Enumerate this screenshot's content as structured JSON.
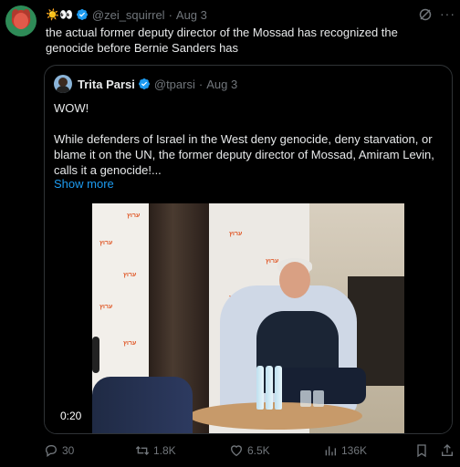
{
  "author": {
    "emoji": "☀️👀",
    "handle": "@zei_squirrel",
    "date": "Aug 3"
  },
  "tweet": {
    "text": "the actual former deputy director of the Mossad has recognized the genocide before Bernie Sanders has"
  },
  "quote": {
    "name": "Trita Parsi",
    "handle": "@tparsi",
    "date": "Aug 3",
    "line1": "WOW!",
    "line2": "While defenders of Israel in the West deny genocide, deny starvation, or blame it on the UN, the former deputy director of Mossad, Amiram Levin, calls it a genocide!...",
    "show_more": "Show more",
    "video_time": "0:20"
  },
  "actions": {
    "replies": "30",
    "retweets": "1.8K",
    "likes": "6.5K",
    "views": "136K"
  },
  "colors": {
    "accent": "#1d9bf0",
    "muted": "#71767b",
    "text": "#e7e9ea",
    "border": "#2f3336"
  },
  "icons": [
    "reply-icon",
    "retweet-icon",
    "like-icon",
    "views-icon",
    "bookmark-icon",
    "share-icon",
    "verified-icon",
    "grok-icon",
    "more-icon"
  ]
}
